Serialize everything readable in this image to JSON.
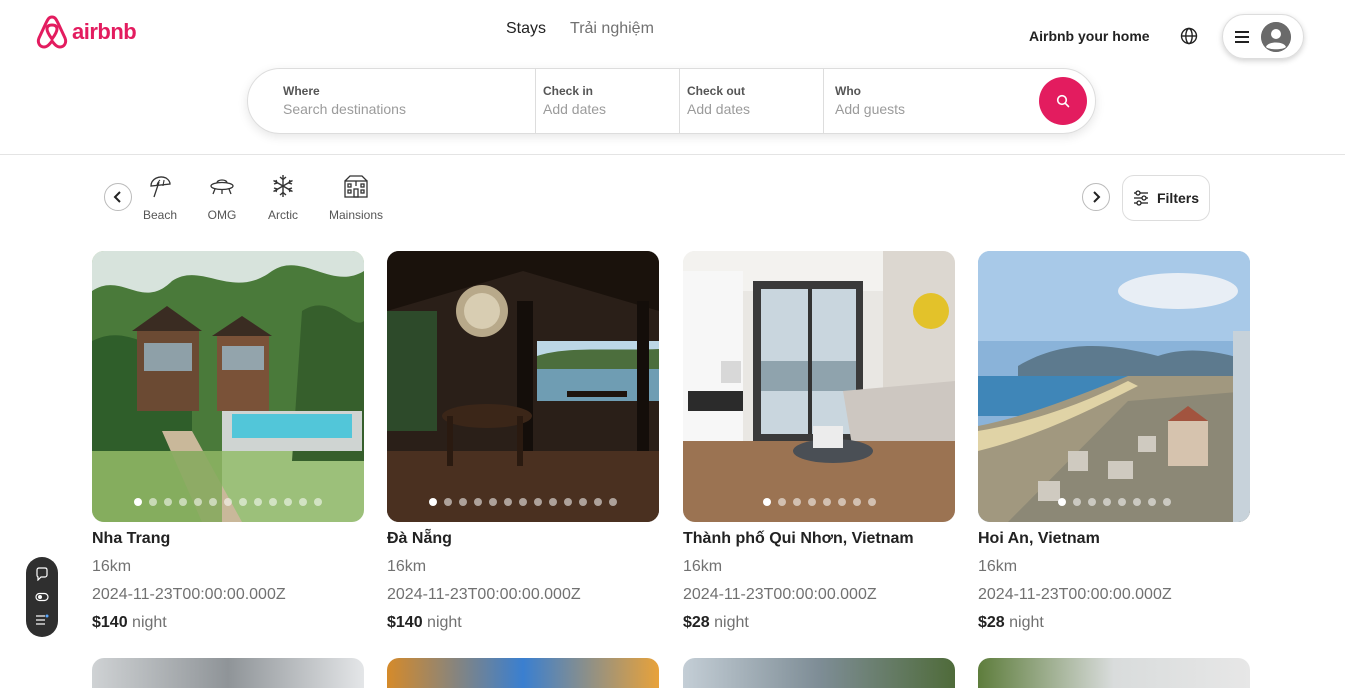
{
  "brand": {
    "name": "airbnb",
    "color": "#e31c5f"
  },
  "nav": {
    "tabs": [
      {
        "label": "Stays",
        "active": true
      },
      {
        "label": "Trải nghiệm",
        "active": false
      }
    ]
  },
  "header": {
    "host_link": "Airbnb your home"
  },
  "search": {
    "where_label": "Where",
    "where_placeholder": "Search destinations",
    "checkin_label": "Check in",
    "checkin_placeholder": "Add dates",
    "checkout_label": "Check out",
    "checkout_placeholder": "Add dates",
    "who_label": "Who",
    "who_placeholder": "Add guests"
  },
  "categories": [
    {
      "label": "Beach",
      "icon": "umbrella-icon"
    },
    {
      "label": "OMG",
      "icon": "ufo-icon"
    },
    {
      "label": "Arctic",
      "icon": "snowflake-icon"
    },
    {
      "label": "Mainsions",
      "icon": "mansion-icon"
    }
  ],
  "filters_label": "Filters",
  "listings": [
    {
      "title": "Nha Trang",
      "distance": "16km",
      "date": "2024-11-23T00:00:00.000Z",
      "price": "$140",
      "unit": "night",
      "dots": 13,
      "active_dot": 0
    },
    {
      "title": "Đà Nẵng",
      "distance": "16km",
      "date": "2024-11-23T00:00:00.000Z",
      "price": "$140",
      "unit": "night",
      "dots": 13,
      "active_dot": 0
    },
    {
      "title": "Thành phố Qui Nhơn, Vietnam",
      "distance": "16km",
      "date": "2024-11-23T00:00:00.000Z",
      "price": "$28",
      "unit": "night",
      "dots": 8,
      "active_dot": 0
    },
    {
      "title": "Hoi An, Vietnam",
      "distance": "16km",
      "date": "2024-11-23T00:00:00.000Z",
      "price": "$28",
      "unit": "night",
      "dots": 8,
      "active_dot": 0
    }
  ]
}
